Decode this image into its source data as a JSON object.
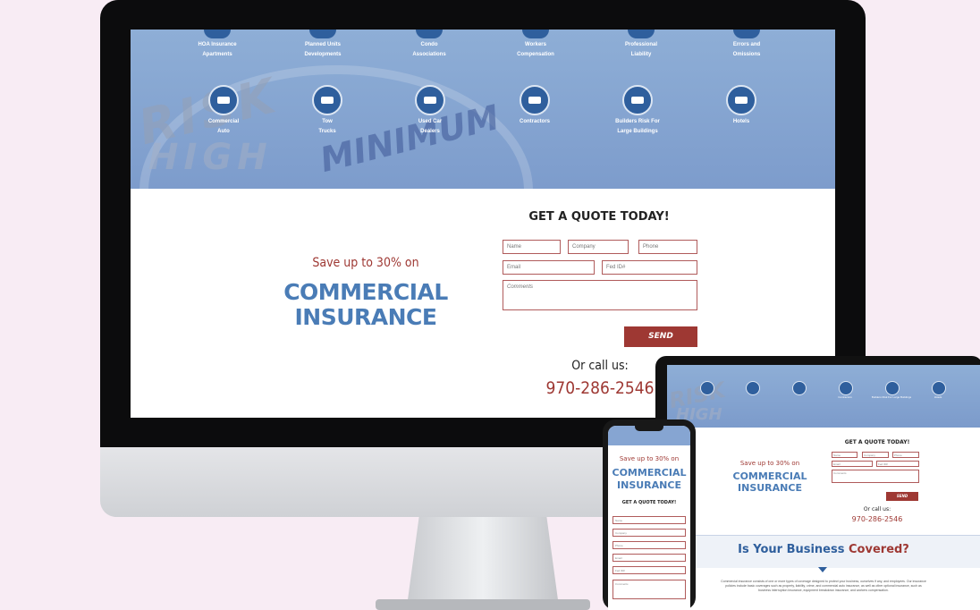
{
  "desktop": {
    "services_top": [
      {
        "line1": "HOA Insurance",
        "line2": "Apartments"
      },
      {
        "line1": "Planned Units",
        "line2": "Developments"
      },
      {
        "line1": "Condo",
        "line2": "Associations"
      },
      {
        "line1": "Workers",
        "line2": "Compensation"
      },
      {
        "line1": "Professional",
        "line2": "Liability"
      },
      {
        "line1": "Errors and",
        "line2": "Omissions"
      }
    ],
    "services_bottom": [
      {
        "line1": "Commercial",
        "line2": "Auto",
        "icon": "car-icon"
      },
      {
        "line1": "Tow",
        "line2": "Trucks",
        "icon": "tow-truck-icon"
      },
      {
        "line1": "Used Car",
        "line2": "Dealers",
        "icon": "used-car-icon"
      },
      {
        "line1": "Contractors",
        "line2": "",
        "icon": "hard-hat-icon"
      },
      {
        "line1": "Builders Risk For",
        "line2": "Large Buildings",
        "icon": "building-icon"
      },
      {
        "line1": "Hotels",
        "line2": "",
        "icon": "hotel-icon"
      }
    ],
    "hero_words": {
      "risk": "RISK",
      "high": "HIGH",
      "minimum": "MINIMUM",
      "risk2": "RISK"
    },
    "save_text": "Save up to 30% on",
    "commercial_line1": "COMMERCIAL",
    "commercial_line2": "INSURANCE",
    "quote_title": "GET A QUOTE TODAY!",
    "fields": {
      "name": "Name",
      "company": "Company",
      "phone": "Phone",
      "email": "Email",
      "fed_id": "Fed ID#",
      "comments": "Comments"
    },
    "send_label": "SEND",
    "or_call": "Or call us:",
    "phone_number": "970-286-2546"
  },
  "tablet": {
    "save_text": "Save up to 30% on",
    "commercial_line1": "COMMERCIAL",
    "commercial_line2": "INSURANCE",
    "quote_title": "GET A QUOTE TODAY!",
    "send_label": "SEND",
    "or_call": "Or call us:",
    "phone_number": "970-286-2546",
    "covered_prefix": "Is Your Business",
    "covered_highlight": "Covered?",
    "icon_labels": [
      "Contractors",
      "Builders Risk For Large Buildings",
      "Hotels"
    ],
    "body_text": "Commercial insurance consists of one or more types of coverage designed to protect your business, ourselves if any, and employees. Our insurance policies include basic coverages such as property, liability, crime, and commercial auto insurance, as well as other optional insurance, such as business interruption insurance, equipment breakdown insurance, and workers compensation."
  },
  "phone": {
    "save_text": "Save up to 30% on",
    "commercial_line1": "COMMERCIAL",
    "commercial_line2": "INSURANCE",
    "quote_title": "GET A QUOTE TODAY!",
    "fields": [
      "Name",
      "Company",
      "Phone",
      "Email",
      "Fed ID#"
    ],
    "comments": "Comments"
  },
  "colors": {
    "brand_blue": "#4a7cb6",
    "brand_red": "#9e3833",
    "hero_blue": "#8eaed6",
    "icon_blue": "#2f5f9d"
  }
}
